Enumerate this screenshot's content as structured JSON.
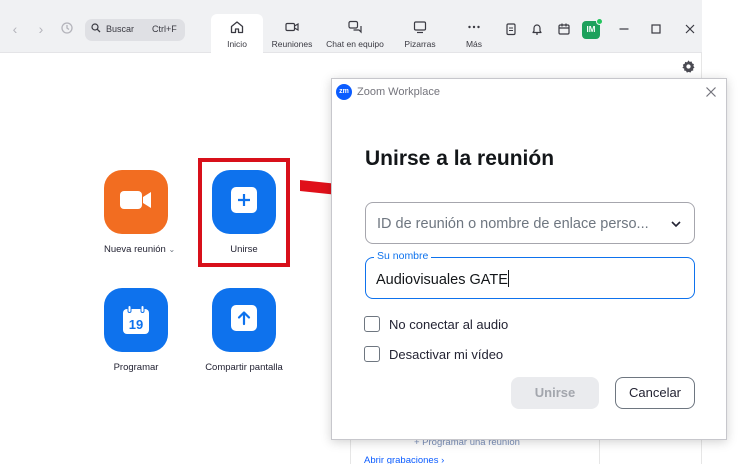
{
  "toolbar": {
    "back_icon": "chevron-left-icon",
    "forward_icon": "chevron-right-icon",
    "history_icon": "history-icon",
    "search_placeholder": "Buscar",
    "search_shortcut": "Ctrl+F"
  },
  "tabs": [
    {
      "label": "Inicio",
      "icon": "home-icon",
      "active": true
    },
    {
      "label": "Reuniones",
      "icon": "video-icon",
      "active": false
    },
    {
      "label": "Chat en equipo",
      "icon": "chat-icon",
      "active": false
    },
    {
      "label": "Pizarras",
      "icon": "whiteboard-icon",
      "active": false
    },
    {
      "label": "Más",
      "icon": "more-icon",
      "active": false
    }
  ],
  "user": {
    "initials": "IM",
    "status_color": "#23c55e",
    "avatar_color": "#1da15c"
  },
  "home": {
    "tiles": [
      {
        "label": "Nueva reunión",
        "dropdown": "⌄",
        "icon": "video-camera-icon",
        "color": "#f26d21"
      },
      {
        "label": "Unirse",
        "icon": "plus-icon",
        "color": "#0e72ed"
      },
      {
        "label": "Programar",
        "icon": "calendar-icon",
        "calendar_day": "19",
        "color": "#0e72ed"
      },
      {
        "label": "Compartir pantalla",
        "icon": "share-screen-icon",
        "color": "#0e72ed"
      }
    ],
    "background_links": {
      "schedule": "+ Programar una reunión",
      "recordings": "Abrir grabaciones ›"
    }
  },
  "annotation": {
    "color": "#d8101a"
  },
  "dialog": {
    "window_title": "Zoom Workplace",
    "logo_text": "zm",
    "heading": "Unirse a la reunión",
    "meeting_id_placeholder": "ID de reunión o nombre de enlace perso...",
    "name_label": "Su nombre",
    "name_value": "Audiovisuales GATE",
    "checkbox_audio": {
      "label": "No conectar al audio",
      "checked": false
    },
    "checkbox_video": {
      "label": "Desactivar mi vídeo",
      "checked": false
    },
    "join_button": "Unirse",
    "cancel_button": "Cancelar",
    "accent_color": "#0e72ed"
  }
}
